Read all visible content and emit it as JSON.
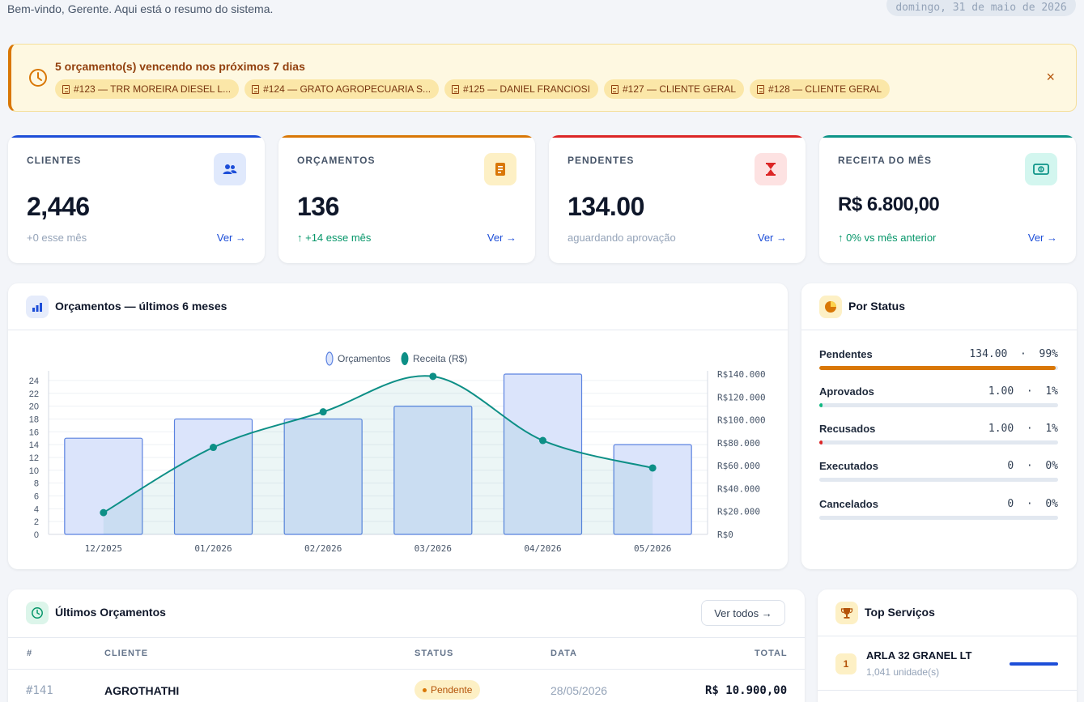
{
  "header": {
    "subtitle": "Bem-vindo, Gerente. Aqui está o resumo do sistema.",
    "date": "domingo, 31 de maio de 2026"
  },
  "alert": {
    "title": "5 orçamento(s) vencendo nos próximos 7 dias",
    "chips": [
      "#123 — TRR MOREIRA DIESEL L...",
      "#124 — GRATO AGROPECUARIA S...",
      "#125 — DANIEL FRANCIOSI",
      "#127 — CLIENTE GERAL",
      "#128 — CLIENTE GERAL"
    ],
    "close": "×"
  },
  "stats": [
    {
      "label": "CLIENTES",
      "value": "2,446",
      "note": "+0 esse mês",
      "link": "Ver →",
      "color": "#1d4ed8",
      "icon_bg": "#e0e9fc",
      "icon": "users-icon"
    },
    {
      "label": "ORÇAMENTOS",
      "value": "136",
      "note": "↑ +14 esse mês",
      "link": "Ver →",
      "color": "#d97706",
      "icon_bg": "#fdf0c5",
      "icon": "document-icon"
    },
    {
      "label": "PENDENTES",
      "value": "134.00",
      "note": "aguardando aprovação",
      "link": "Ver →",
      "color": "#dc2626",
      "icon_bg": "#fde2e2",
      "icon": "hourglass-icon"
    },
    {
      "label": "RECEITA DO MÊS",
      "value": "R$ 6.800,00",
      "note": "↑ 0% vs mês anterior",
      "link": "Ver →",
      "color": "#0d9488",
      "icon_bg": "#d3f6ef",
      "icon": "money-icon"
    }
  ],
  "chart_panel": {
    "title": "Orçamentos — últimos 6 meses",
    "icon": "bar-chart-icon"
  },
  "chart_data": {
    "type": "bar",
    "categories": [
      "12/2025",
      "01/2026",
      "02/2026",
      "03/2026",
      "04/2026",
      "05/2026"
    ],
    "series": [
      {
        "name": "Orçamentos",
        "type": "bar",
        "axis": "left",
        "values": [
          15,
          18,
          18,
          20,
          25,
          14
        ]
      },
      {
        "name": "Receita (R$)",
        "type": "line",
        "axis": "right",
        "values": [
          19000,
          76000,
          107000,
          138000,
          82000,
          58000
        ]
      }
    ],
    "y_left": {
      "min": 0,
      "max": 25,
      "ticks": [
        0,
        2,
        4,
        6,
        8,
        10,
        12,
        14,
        16,
        18,
        20,
        22,
        24
      ]
    },
    "y_right": {
      "min": 0,
      "max": 140000,
      "ticks": [
        "R$0",
        "R$20.000",
        "R$40.000",
        "R$60.000",
        "R$80.000",
        "R$100.000",
        "R$120.000",
        "R$140.000"
      ]
    },
    "legend": "top-center",
    "grid": true,
    "colors": {
      "bar_fill": "#dbe4fb",
      "bar_stroke": "#5b82e0",
      "line": "#0d8f86"
    }
  },
  "status_panel": {
    "title": "Por Status",
    "icon": "pie-chart-icon",
    "rows": [
      {
        "label": "Pendentes",
        "value": "134.00",
        "sep": "·",
        "pct": "99%",
        "fill": 0.99,
        "color": "#d97706"
      },
      {
        "label": "Aprovados",
        "value": "1.00",
        "sep": "·",
        "pct": "1%",
        "fill": 0.01,
        "color": "#10b981"
      },
      {
        "label": "Recusados",
        "value": "1.00",
        "sep": "·",
        "pct": "1%",
        "fill": 0.01,
        "color": "#dc2626"
      },
      {
        "label": "Executados",
        "value": "0",
        "sep": "·",
        "pct": "0%",
        "fill": 0,
        "color": "#64748b"
      },
      {
        "label": "Cancelados",
        "value": "0",
        "sep": "·",
        "pct": "0%",
        "fill": 0,
        "color": "#64748b"
      }
    ]
  },
  "latest": {
    "title": "Últimos Orçamentos",
    "view_all": "Ver todos →",
    "columns": [
      "#",
      "CLIENTE",
      "STATUS",
      "DATA",
      "TOTAL"
    ],
    "rows": [
      {
        "id": "#141",
        "client": "AGROTHATHI",
        "status": "Pendente",
        "date": "28/05/2026",
        "total": "R$ 10.900,00"
      }
    ]
  },
  "top_services": {
    "title": "Top Serviços",
    "items": [
      {
        "rank": "1",
        "name": "ARLA 32 GRANEL LT",
        "sub": "1,041 unidade(s)",
        "share": 1
      }
    ]
  }
}
